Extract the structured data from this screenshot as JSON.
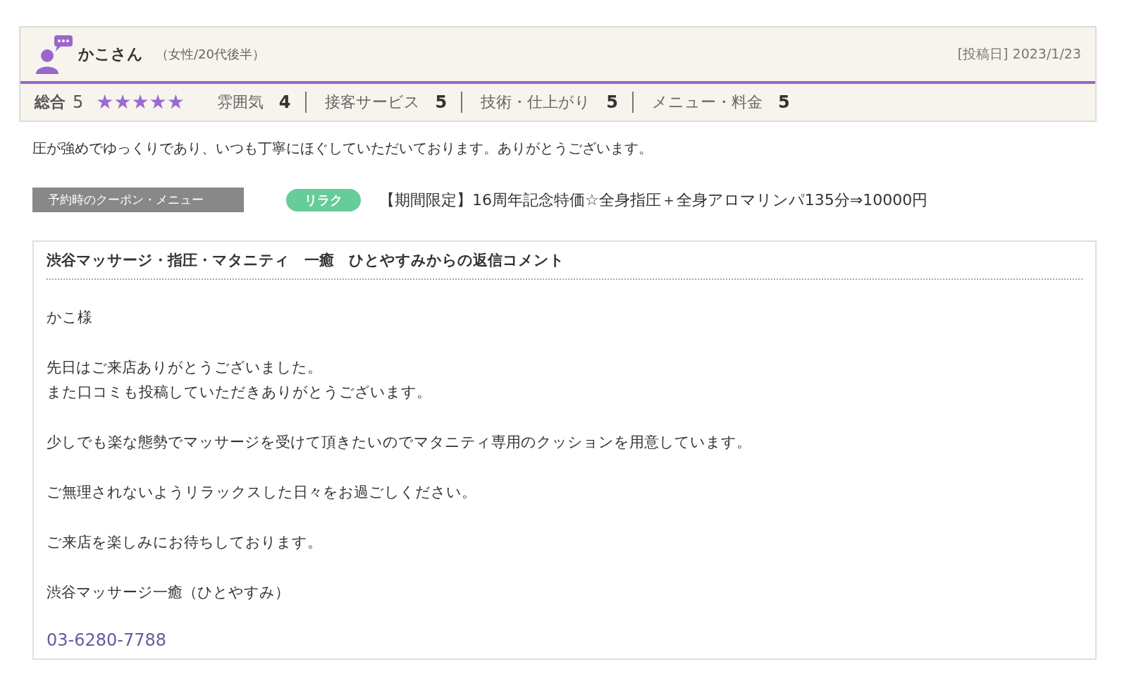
{
  "review": {
    "author": "かこさん",
    "profile": "（女性/20代後半）",
    "posted": "[投稿日] 2023/1/23",
    "overall": {
      "label": "総合",
      "score": "5",
      "stars": 5
    },
    "ratings": [
      {
        "label": "雰囲気",
        "score": "4"
      },
      {
        "label": "接客サービス",
        "score": "5"
      },
      {
        "label": "技術・仕上がり",
        "score": "5"
      },
      {
        "label": "メニュー・料金",
        "score": "5"
      }
    ],
    "comment": "圧が強めでゆっくりであり、いつも丁寧にほぐしていただいております。ありがとうございます。",
    "coupon": {
      "label": "予約時のクーポン・メニュー",
      "tag": "リラク",
      "title": "【期間限定】16周年記念特価☆全身指圧＋全身アロマリンパ135分⇒10000円"
    }
  },
  "reply": {
    "title": "渋谷マッサージ・指圧・マタニティ　一癒　ひとやすみからの返信コメント",
    "paragraphs": [
      [
        "かこ様"
      ],
      [
        "先日はご来店ありがとうございました。",
        "また口コミも投稿していただきありがとうございます。"
      ],
      [
        "少しでも楽な態勢でマッサージを受けて頂きたいのでマタニティ専用のクッションを用意しています。"
      ],
      [
        "ご無理されないようリラックスした日々をお過ごしください。"
      ],
      [
        "ご来店を楽しみにお待ちしております。"
      ],
      [
        "渋谷マッサージ一癒（ひとやすみ）"
      ]
    ],
    "phone": "03-6280-7788"
  }
}
